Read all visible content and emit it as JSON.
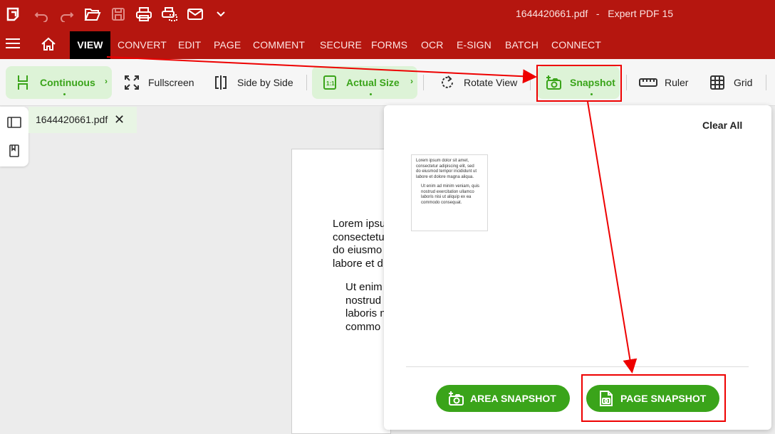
{
  "titlebar": {
    "file_name": "1644420661.pdf",
    "separator": "-",
    "app_name": "Expert PDF 15"
  },
  "menu": {
    "items": [
      "VIEW",
      "CONVERT",
      "EDIT",
      "PAGE",
      "COMMENT",
      "SECURE",
      "FORMS",
      "OCR",
      "E-SIGN",
      "BATCH",
      "CONNECT"
    ],
    "active": "VIEW"
  },
  "ribbon": {
    "continuous": "Continuous",
    "fullscreen": "Fullscreen",
    "side_by_side": "Side by Side",
    "actual_size": "Actual Size",
    "rotate_view": "Rotate View",
    "snapshot": "Snapshot",
    "ruler": "Ruler",
    "grid": "Grid"
  },
  "doctab": {
    "name": "1644420661.pdf"
  },
  "document": {
    "para1": [
      "Lorem ipsu",
      "consectetu",
      "do eiusmo",
      "labore et d"
    ],
    "para2": [
      "Ut enim",
      "nostrud",
      "laboris n",
      "commo"
    ]
  },
  "snapshot_panel": {
    "clear_all": "Clear All",
    "thumbnail": {
      "para1": [
        "Lorem ipsum dolor sit amet,",
        "consectetur adipiscing elit, sed",
        "do eiusmod tempor incididunt ut",
        "labore et dolore magna aliqua."
      ],
      "para2": [
        "Ut enim ad minim veniam, quis",
        "nostrud exercitation ullamco",
        "laboris nisi ut aliquip ex ea",
        "commodo consequat."
      ]
    },
    "area_snapshot": "AREA SNAPSHOT",
    "page_snapshot": "PAGE SNAPSHOT"
  },
  "colors": {
    "brand_red": "#b5160f",
    "accent_green": "#3aa41a",
    "annotation_red": "#ee0000"
  }
}
